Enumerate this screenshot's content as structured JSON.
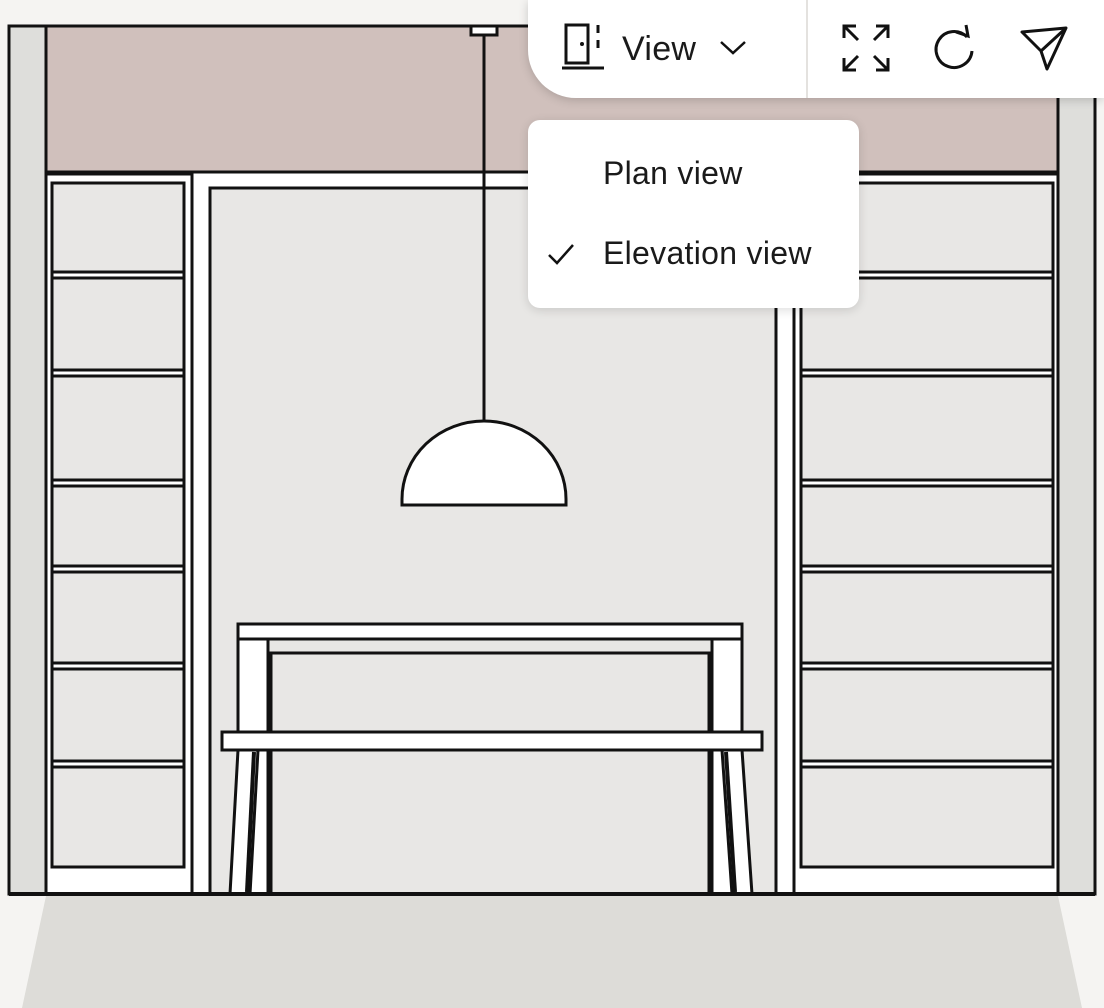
{
  "toolbar": {
    "view_label": "View",
    "icons": {
      "view_mode": "elevation-view-icon",
      "dropdown": "chevron-down-icon",
      "fullscreen": "expand-icon",
      "rotate": "rotate-icon",
      "share": "send-icon"
    }
  },
  "view_menu": {
    "items": [
      {
        "label": "Plan view",
        "selected": false
      },
      {
        "label": "Elevation view",
        "selected": true
      }
    ]
  },
  "colors": {
    "page_background": "#f5f4f2",
    "wall_upper": "#d0c0bc",
    "wall": "#e8e7e5",
    "side_wall": "#dededb",
    "floor": "#dddcd8",
    "line": "#111111",
    "fixture": "#ffffff"
  }
}
